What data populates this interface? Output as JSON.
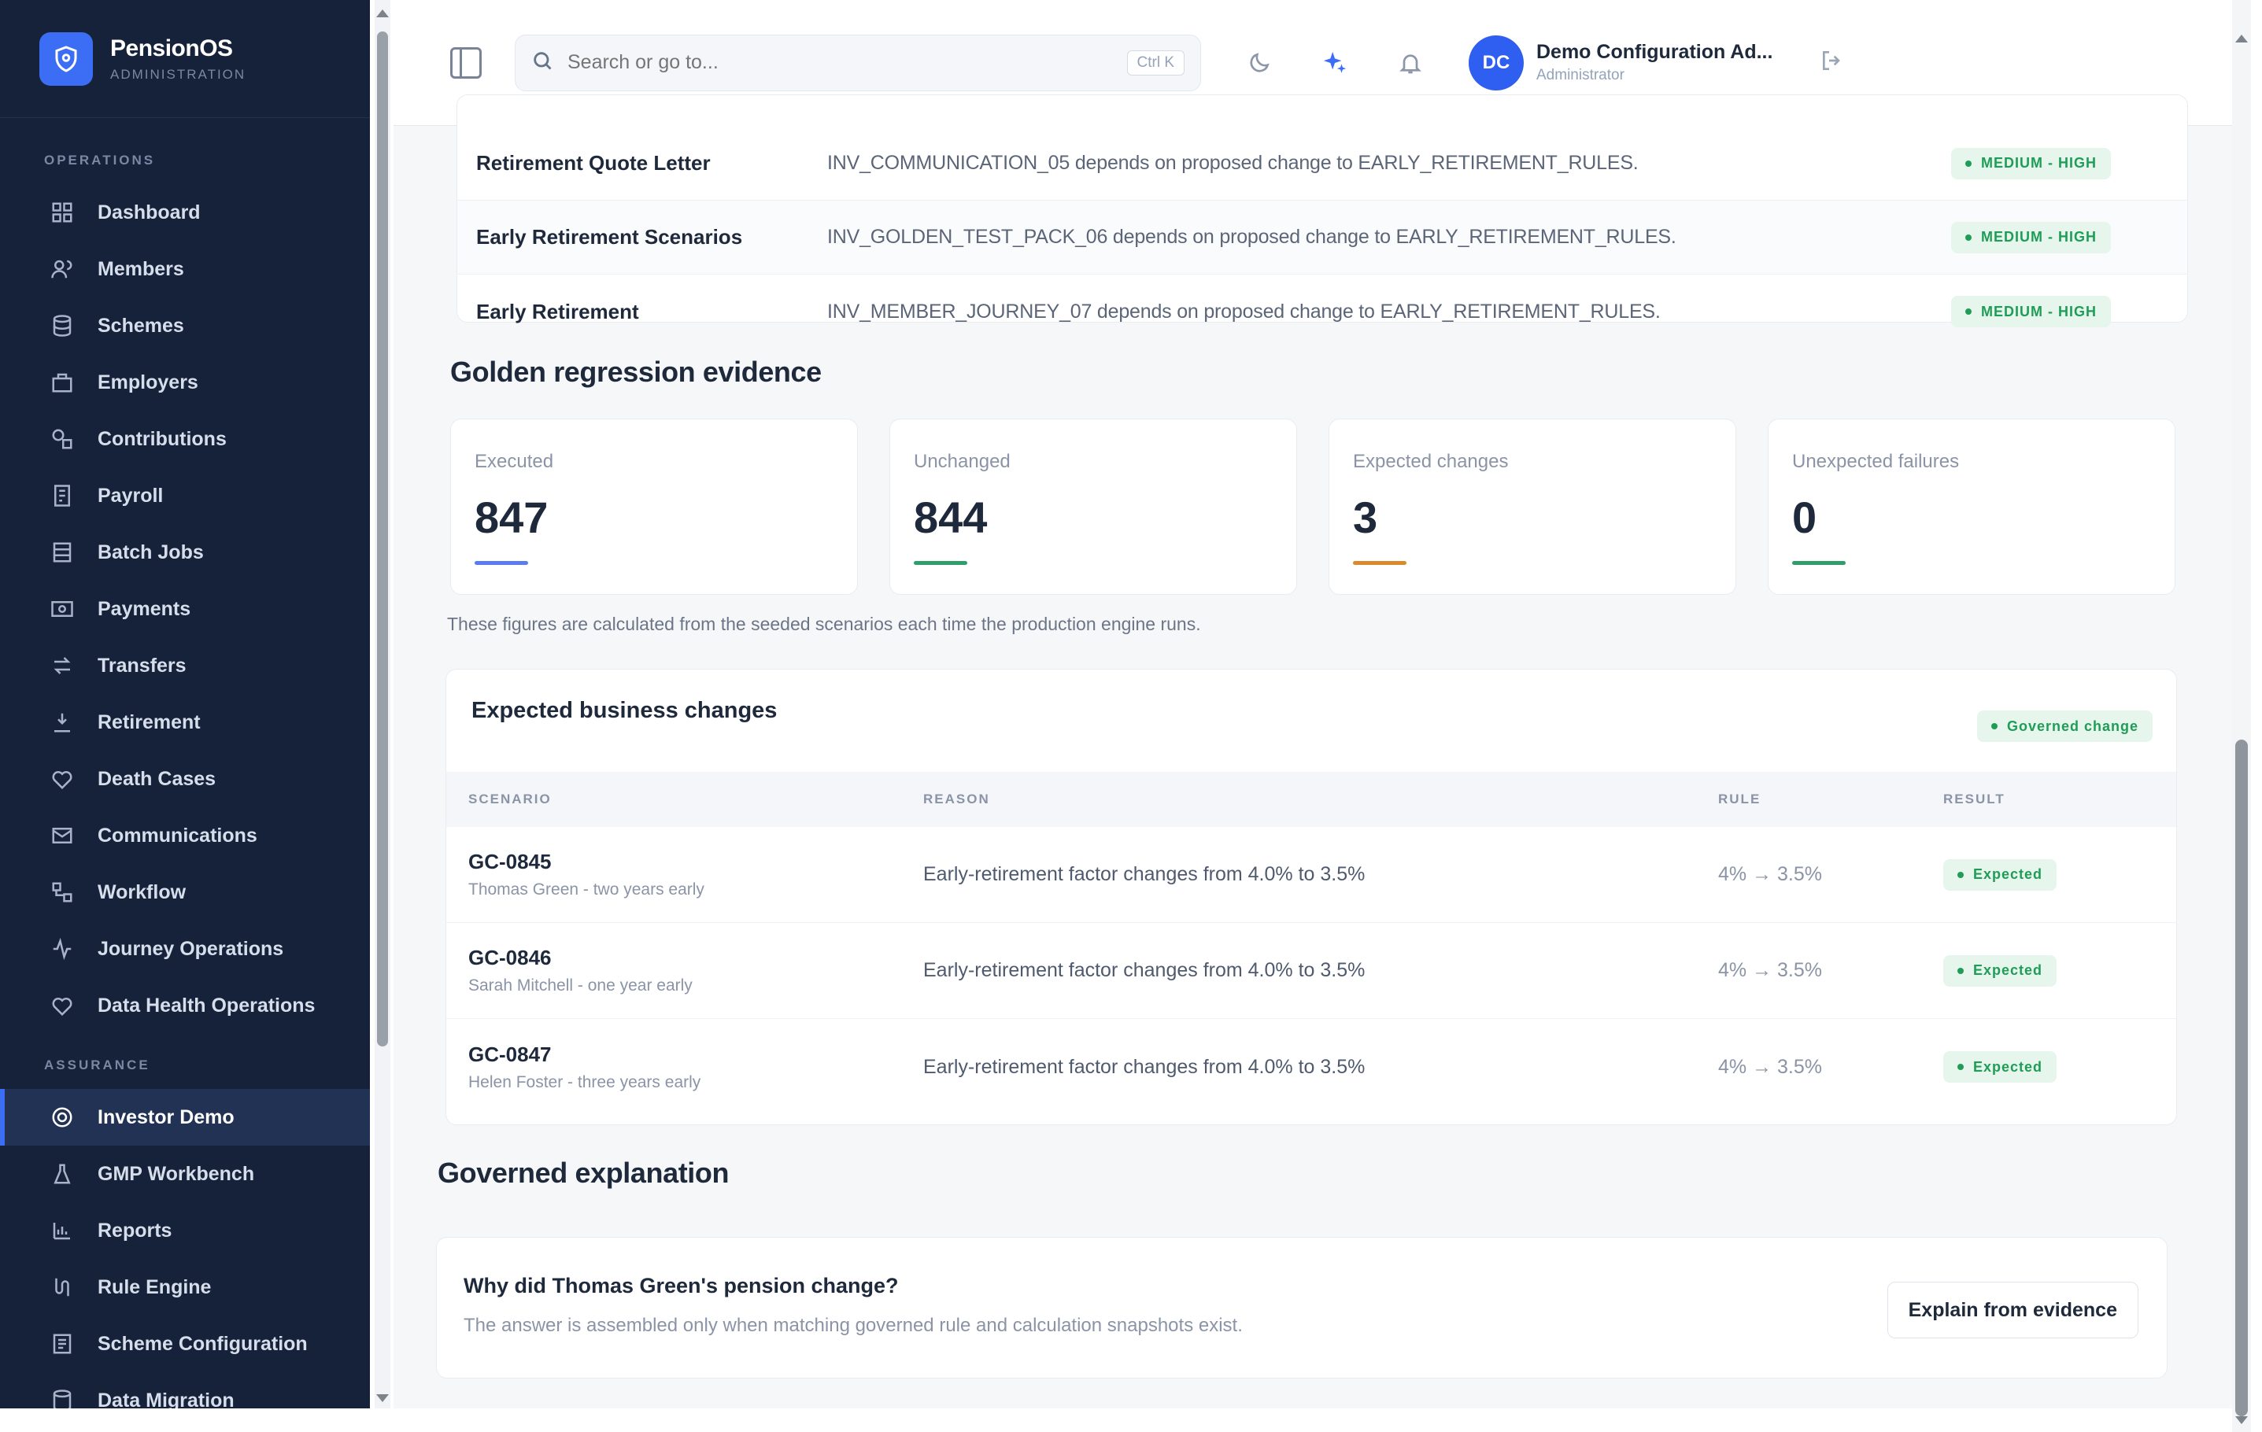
{
  "brand": {
    "name": "PensionOS",
    "subtitle": "ADMINISTRATION"
  },
  "sidebar": {
    "operations_label": "OPERATIONS",
    "operations": [
      {
        "label": "Dashboard",
        "icon": "dashboard-icon"
      },
      {
        "label": "Members",
        "icon": "members-icon"
      },
      {
        "label": "Schemes",
        "icon": "schemes-icon"
      },
      {
        "label": "Employers",
        "icon": "employers-icon"
      },
      {
        "label": "Contributions",
        "icon": "contributions-icon"
      },
      {
        "label": "Payroll",
        "icon": "payroll-icon"
      },
      {
        "label": "Batch Jobs",
        "icon": "batch-jobs-icon"
      },
      {
        "label": "Payments",
        "icon": "payments-icon"
      },
      {
        "label": "Transfers",
        "icon": "transfers-icon"
      },
      {
        "label": "Retirement",
        "icon": "retirement-icon"
      },
      {
        "label": "Death Cases",
        "icon": "death-cases-icon"
      },
      {
        "label": "Communications",
        "icon": "communications-icon"
      },
      {
        "label": "Workflow",
        "icon": "workflow-icon"
      },
      {
        "label": "Journey Operations",
        "icon": "journey-icon"
      },
      {
        "label": "Data Health Operations",
        "icon": "data-health-icon"
      }
    ],
    "assurance_label": "ASSURANCE",
    "assurance": [
      {
        "label": "Investor Demo",
        "icon": "investor-demo-icon",
        "active": true
      },
      {
        "label": "GMP Workbench",
        "icon": "gmp-icon"
      },
      {
        "label": "Reports",
        "icon": "reports-icon"
      },
      {
        "label": "Rule Engine",
        "icon": "rule-engine-icon"
      },
      {
        "label": "Scheme Configuration",
        "icon": "scheme-config-icon"
      },
      {
        "label": "Data Migration",
        "icon": "data-migration-icon"
      }
    ]
  },
  "header": {
    "search_placeholder": "Search or go to...",
    "shortcut": "Ctrl K",
    "user_initials": "DC",
    "user_name": "Demo Configuration Ad...",
    "user_role": "Administrator"
  },
  "impact_rows": [
    {
      "name": "Retirement Quote Letter",
      "detail": "INV_COMMUNICATION_05 depends on proposed change to EARLY_RETIREMENT_RULES.",
      "severity": "MEDIUM - HIGH"
    },
    {
      "name": "Early Retirement Scenarios",
      "detail": "INV_GOLDEN_TEST_PACK_06 depends on proposed change to EARLY_RETIREMENT_RULES.",
      "severity": "MEDIUM - HIGH"
    },
    {
      "name": "Early Retirement",
      "detail": "INV_MEMBER_JOURNEY_07 depends on proposed change to EARLY_RETIREMENT_RULES.",
      "severity": "MEDIUM - HIGH"
    }
  ],
  "regression": {
    "title": "Golden regression evidence",
    "metrics": [
      {
        "label": "Executed",
        "value": "847",
        "color": "#5b7cf0"
      },
      {
        "label": "Unchanged",
        "value": "844",
        "color": "#2f9e6b"
      },
      {
        "label": "Expected changes",
        "value": "3",
        "color": "#d98a2b"
      },
      {
        "label": "Unexpected failures",
        "value": "0",
        "color": "#2f9e6b"
      }
    ],
    "footnote": "These figures are calculated from the seeded scenarios each time the production engine runs."
  },
  "changes": {
    "title": "Expected business changes",
    "badge": "Governed change",
    "columns": [
      "SCENARIO",
      "REASON",
      "RULE",
      "RESULT"
    ],
    "rows": [
      {
        "id": "GC-0845",
        "desc": "Thomas Green - two years early",
        "reason": "Early-retirement factor changes from 4.0% to 3.5%",
        "rule": "4% → 3.5%",
        "result": "Expected"
      },
      {
        "id": "GC-0846",
        "desc": "Sarah Mitchell - one year early",
        "reason": "Early-retirement factor changes from 4.0% to 3.5%",
        "rule": "4% → 3.5%",
        "result": "Expected"
      },
      {
        "id": "GC-0847",
        "desc": "Helen Foster - three years early",
        "reason": "Early-retirement factor changes from 4.0% to 3.5%",
        "rule": "4% → 3.5%",
        "result": "Expected"
      }
    ]
  },
  "explanation": {
    "title": "Governed explanation",
    "question": "Why did Thomas Green's pension change?",
    "subtitle": "The answer is assembled only when matching governed rule and calculation snapshots exist.",
    "button": "Explain from evidence"
  },
  "colors": {
    "sidebar": "#16213a",
    "accent": "#3b6ef5",
    "success": "#1f9d57"
  }
}
